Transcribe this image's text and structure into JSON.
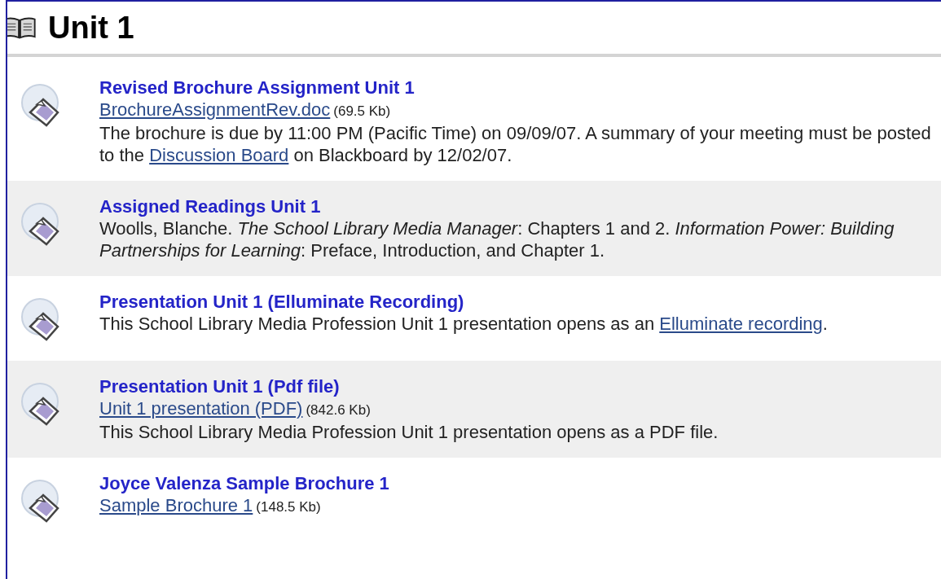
{
  "heading": "Unit 1",
  "items": [
    {
      "title": "Revised Brochure Assignment Unit 1",
      "shaded": false,
      "file": {
        "name": "BrochureAssignmentRev.doc",
        "size": "(69.5 Kb)"
      },
      "description": [
        {
          "kind": "text",
          "text": "The brochure is due by 11:00 PM (Pacific Time) on 09/09/07. A summary of your meeting must be posted to the "
        },
        {
          "kind": "link",
          "text": "Discussion Board"
        },
        {
          "kind": "text",
          "text": " on Blackboard by 12/02/07."
        }
      ]
    },
    {
      "title": "Assigned Readings Unit 1",
      "shaded": true,
      "description": [
        {
          "kind": "text",
          "text": "Woolls, Blanche. *The School Library Media Manager*: Chapters 1 and 2. *Information Power: Building Partnerships for Learning*: Preface, Introduction, and Chapter 1."
        }
      ]
    },
    {
      "title": "Presentation Unit 1 (Elluminate Recording)",
      "shaded": false,
      "description": [
        {
          "kind": "text",
          "text": "This School Library Media Profession Unit 1 presentation opens as an "
        },
        {
          "kind": "link",
          "text": "Elluminate recording"
        },
        {
          "kind": "text",
          "text": "."
        }
      ]
    },
    {
      "title": "Presentation Unit 1 (Pdf file)",
      "shaded": true,
      "file": {
        "name": "Unit 1 presentation (PDF)",
        "size": "(842.6 Kb)"
      },
      "description": [
        {
          "kind": "text",
          "text": "This School Library Media Profession Unit 1 presentation opens as a PDF file."
        }
      ]
    },
    {
      "title": "Joyce Valenza Sample Brochure 1",
      "shaded": false,
      "file": {
        "name": "Sample Brochure 1",
        "size": "(148.5 Kb)"
      }
    }
  ]
}
